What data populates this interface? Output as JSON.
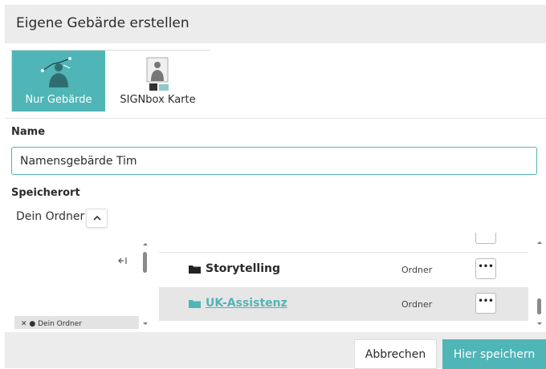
{
  "dialog": {
    "title": "Eigene Gebärde erstellen"
  },
  "type_options": [
    {
      "label": "Nur Gebärde",
      "active": true,
      "icon": "sign-figure-icon"
    },
    {
      "label": "SIGNbox Karte",
      "active": false,
      "icon": "signbox-card-icon"
    }
  ],
  "name_section": {
    "label": "Name",
    "value": "Namensgebärde Tim"
  },
  "location": {
    "label": "Speicherort",
    "current_folder": "Dein Ordner",
    "tree_node": "Dein Ordner"
  },
  "folders": [
    {
      "name": "Storytelling",
      "type": "Ordner",
      "selected": false
    },
    {
      "name": "UK-Assistenz",
      "type": "Ordner",
      "selected": true
    }
  ],
  "more_label": "•••",
  "footer": {
    "cancel_label": "Abbrechen",
    "save_label": "Hier speichern"
  },
  "colors": {
    "accent": "#50b5b6",
    "header_bg": "#ececec"
  }
}
